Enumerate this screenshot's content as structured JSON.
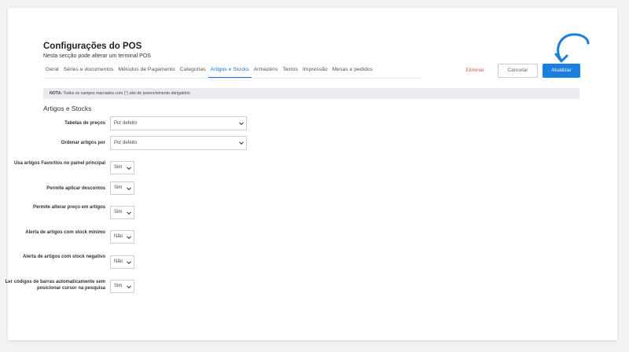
{
  "page": {
    "title": "Configurações do POS",
    "subtitle": "Nesta secção pode alterar um terminal POS"
  },
  "tabs": [
    {
      "label": "Geral"
    },
    {
      "label": "Séries e documentos"
    },
    {
      "label": "Métodos de Pagamento"
    },
    {
      "label": "Categorias"
    },
    {
      "label": "Artigos e Stocks",
      "active": true
    },
    {
      "label": "Armazéns"
    },
    {
      "label": "Textos"
    },
    {
      "label": "Impressão"
    },
    {
      "label": "Mesas e pedidos"
    }
  ],
  "actions": {
    "delete_label": "Eliminar",
    "cancel_label": "Cancelar",
    "update_label": "Atualizar"
  },
  "note": {
    "prefix": "NOTA:",
    "text_before": " Todos os campos marcados com (",
    "star": "*",
    "text_after": ") são de preenchimento obrigatório"
  },
  "section": {
    "title": "Artigos e Stocks"
  },
  "fields": [
    {
      "label": "Tabelas de preços",
      "value": "Por defeito"
    },
    {
      "label": "Ordenar artigos por",
      "value": "Por defeito"
    },
    {
      "label": "Usa artigos Favoritos no painel principal",
      "value": "Sim"
    },
    {
      "label": "Permite aplicar descontos",
      "value": "Sim"
    },
    {
      "label": "Permite alterar preço em artigos",
      "value": "Sim"
    },
    {
      "label": "Alerta de artigos com stock mínimo",
      "value": "Não"
    },
    {
      "label": "Alerta de artigos com stock negativo",
      "value": "Não"
    },
    {
      "label": "Ler códigos de barras automaticamente sem posicionar cursor na pesquisa",
      "value": "Sim"
    }
  ],
  "colors": {
    "accent": "#1a7fe0",
    "danger": "#e05a4f"
  }
}
